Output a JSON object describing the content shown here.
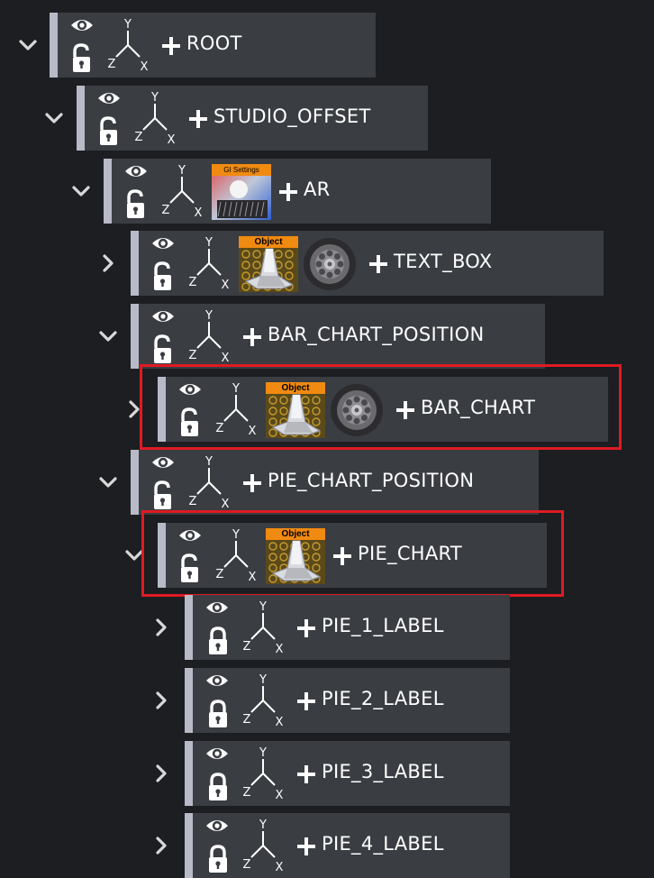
{
  "colors": {
    "background": "#1c1e22",
    "panel": "#3a3d42",
    "panel_edge": "#b8bac8",
    "highlight": "#e01a22",
    "thumbnail_label": "#f08a10",
    "text": "#ffffff"
  },
  "tree": {
    "nodes": [
      {
        "id": "root",
        "label": "ROOT",
        "expanded": true,
        "lock": "unlocked",
        "thumbnails": [],
        "highlighted": false,
        "icons": {
          "chevron": "chevron-down-icon",
          "eye": "eye-icon",
          "lock": "unlock-icon",
          "axis": "axis-gizmo-icon",
          "add": "plus-icon"
        }
      },
      {
        "id": "studio-offset",
        "label": "STUDIO_OFFSET",
        "expanded": true,
        "lock": "unlocked",
        "thumbnails": [],
        "highlighted": false
      },
      {
        "id": "ar",
        "label": "AR",
        "expanded": true,
        "lock": "unlocked",
        "thumbnails": [
          "gi-settings"
        ],
        "highlighted": false
      },
      {
        "id": "text-box",
        "label": "TEXT_BOX",
        "expanded": false,
        "lock": "unlocked",
        "thumbnails": [
          "object",
          "wheel"
        ],
        "highlighted": false
      },
      {
        "id": "bar-chart-position",
        "label": "BAR_CHART_POSITION",
        "expanded": true,
        "lock": "unlocked",
        "thumbnails": [],
        "highlighted": false
      },
      {
        "id": "bar-chart",
        "label": "BAR_CHART",
        "expanded": false,
        "lock": "unlocked",
        "thumbnails": [
          "object",
          "wheel"
        ],
        "highlighted": true
      },
      {
        "id": "pie-chart-position",
        "label": "PIE_CHART_POSITION",
        "expanded": true,
        "lock": "unlocked",
        "thumbnails": [],
        "highlighted": false
      },
      {
        "id": "pie-chart",
        "label": "PIE_CHART",
        "expanded": true,
        "lock": "unlocked",
        "thumbnails": [
          "object"
        ],
        "highlighted": true
      },
      {
        "id": "pie-1-label",
        "label": "PIE_1_LABEL",
        "expanded": false,
        "lock": "locked",
        "thumbnails": [],
        "highlighted": false
      },
      {
        "id": "pie-2-label",
        "label": "PIE_2_LABEL",
        "expanded": false,
        "lock": "locked",
        "thumbnails": [],
        "highlighted": false
      },
      {
        "id": "pie-3-label",
        "label": "PIE_3_LABEL",
        "expanded": false,
        "lock": "locked",
        "thumbnails": [],
        "highlighted": false
      },
      {
        "id": "pie-4-label",
        "label": "PIE_4_LABEL",
        "expanded": false,
        "lock": "locked",
        "thumbnails": [],
        "highlighted": false
      }
    ],
    "thumbnail_labels": {
      "gi-settings": "GI Settings",
      "object": "Object"
    },
    "axis_labels": {
      "x": "X",
      "y": "Y",
      "z": "Z"
    }
  }
}
